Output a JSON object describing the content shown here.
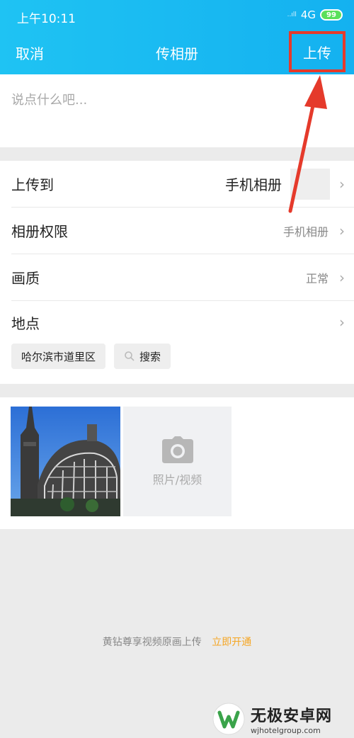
{
  "status": {
    "time": "上午10:11",
    "network": "4G",
    "battery": "99",
    "signal_text": "..ıll"
  },
  "nav": {
    "cancel": "取消",
    "title": "传相册",
    "upload": "上传"
  },
  "compose": {
    "placeholder": "说点什么吧..."
  },
  "settings": {
    "upload_to": {
      "label": "上传到",
      "value": "手机相册"
    },
    "permission": {
      "label": "相册权限",
      "value": "手机相册"
    },
    "quality": {
      "label": "画质",
      "value": "正常"
    },
    "location": {
      "label": "地点"
    },
    "chips": {
      "city": "哈尔滨市道里区",
      "search": "搜索"
    }
  },
  "media": {
    "add_label": "照片/视频"
  },
  "promo": {
    "text": "黄钻尊享视频原画上传",
    "link": "立即开通"
  },
  "watermark": {
    "name": "无极安卓网",
    "url": "wjhotelgroup.com"
  },
  "colors": {
    "header": "#14b1f0",
    "highlight": "#e53a2b",
    "promo_link": "#f5a623"
  }
}
